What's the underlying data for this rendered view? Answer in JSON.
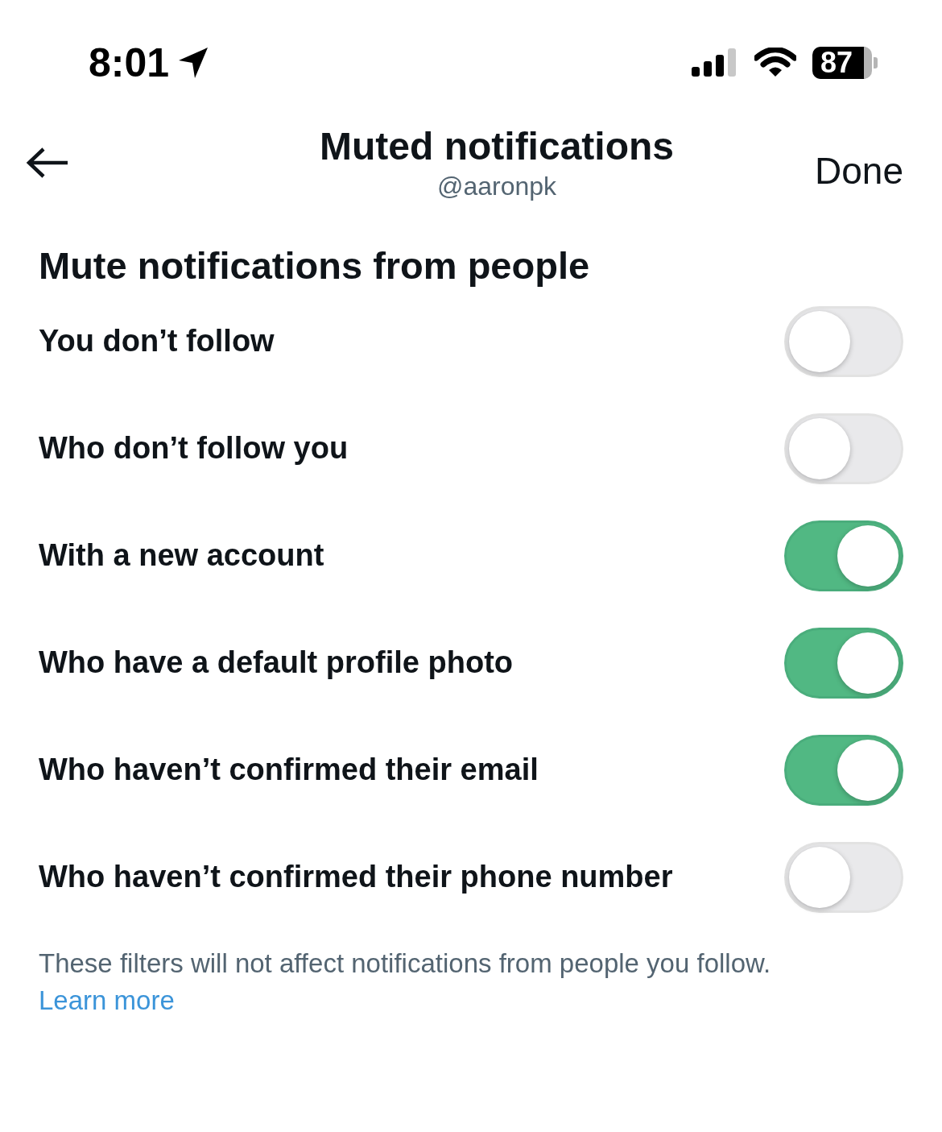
{
  "status_bar": {
    "time": "8:01",
    "battery": "87"
  },
  "header": {
    "title": "Muted notifications",
    "subtitle": "@aaronpk",
    "done": "Done"
  },
  "section": {
    "title": "Mute notifications from people"
  },
  "options": [
    {
      "label": "You don’t follow",
      "on": false
    },
    {
      "label": "Who don’t follow you",
      "on": false
    },
    {
      "label": "With a new account",
      "on": true
    },
    {
      "label": "Who have a default profile photo",
      "on": true
    },
    {
      "label": "Who haven’t confirmed their email",
      "on": true
    },
    {
      "label": "Who haven’t confirmed their phone number",
      "on": false
    }
  ],
  "footer": {
    "text": "These filters will not affect notifications from people you follow.",
    "link": "Learn more"
  }
}
